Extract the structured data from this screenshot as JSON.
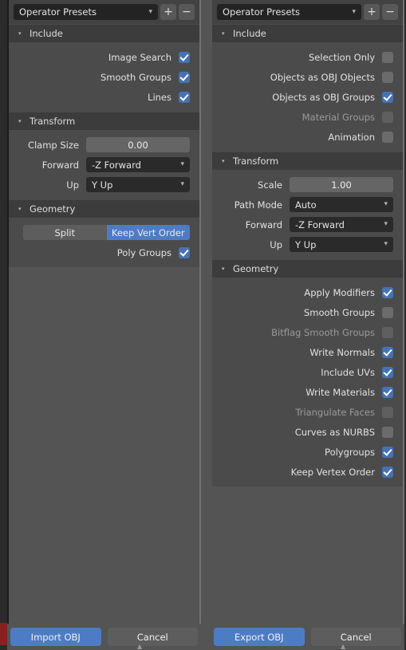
{
  "colors": {
    "accent_blue": "#4e7cc4",
    "checkbox_blue": "#4772b3",
    "panel_bg": "#545454",
    "body_bg": "#4b4b4b",
    "section_header_bg": "#3c3c3c",
    "window_bg": "#2b2b2b",
    "red_marker": "#8a1f1f"
  },
  "import_panel": {
    "preset": {
      "value": "Operator Presets",
      "chevron": "chevron-down-icon",
      "add_label": "+",
      "remove_label": "−"
    },
    "sections": [
      {
        "title": "Include",
        "triangle": "▾",
        "rows": [
          {
            "type": "checkbox",
            "label": "Image Search",
            "checked": true,
            "disabled": false
          },
          {
            "type": "checkbox",
            "label": "Smooth Groups",
            "checked": true,
            "disabled": false
          },
          {
            "type": "checkbox",
            "label": "Lines",
            "checked": true,
            "disabled": false
          }
        ]
      },
      {
        "title": "Transform",
        "triangle": "▾",
        "rows": [
          {
            "type": "value",
            "label": "Clamp Size",
            "value": "0.00"
          },
          {
            "type": "dropdown",
            "label": "Forward",
            "value": "-Z Forward"
          },
          {
            "type": "dropdown",
            "label": "Up",
            "value": "Y Up"
          }
        ]
      },
      {
        "title": "Geometry",
        "triangle": "▾",
        "rows": [
          {
            "type": "toggle",
            "options": [
              "Split",
              "Keep Vert Order"
            ],
            "selected": "Keep Vert Order"
          },
          {
            "type": "checkbox",
            "label": "Poly Groups",
            "checked": true,
            "disabled": false
          }
        ]
      }
    ],
    "buttons": {
      "confirm": "Import OBJ",
      "cancel": "Cancel"
    }
  },
  "export_panel": {
    "preset": {
      "value": "Operator Presets",
      "chevron": "chevron-down-icon",
      "add_label": "+",
      "remove_label": "−"
    },
    "sections": [
      {
        "title": "Include",
        "triangle": "▾",
        "rows": [
          {
            "type": "checkbox",
            "label": "Selection Only",
            "checked": false,
            "disabled": false
          },
          {
            "type": "checkbox",
            "label": "Objects as OBJ Objects",
            "checked": false,
            "disabled": false
          },
          {
            "type": "checkbox",
            "label": "Objects as OBJ Groups",
            "checked": true,
            "disabled": false
          },
          {
            "type": "checkbox",
            "label": "Material Groups",
            "checked": false,
            "disabled": true
          },
          {
            "type": "checkbox",
            "label": "Animation",
            "checked": false,
            "disabled": false
          }
        ]
      },
      {
        "title": "Transform",
        "triangle": "▾",
        "rows": [
          {
            "type": "value",
            "label": "Scale",
            "value": "1.00"
          },
          {
            "type": "dropdown",
            "label": "Path Mode",
            "value": "Auto"
          },
          {
            "type": "dropdown",
            "label": "Forward",
            "value": "-Z Forward"
          },
          {
            "type": "dropdown",
            "label": "Up",
            "value": "Y Up"
          }
        ]
      },
      {
        "title": "Geometry",
        "triangle": "▾",
        "rows": [
          {
            "type": "checkbox",
            "label": "Apply Modifiers",
            "checked": true,
            "disabled": false
          },
          {
            "type": "checkbox",
            "label": "Smooth Groups",
            "checked": false,
            "disabled": false
          },
          {
            "type": "checkbox",
            "label": "Bitflag Smooth Groups",
            "checked": false,
            "disabled": true
          },
          {
            "type": "checkbox",
            "label": "Write Normals",
            "checked": true,
            "disabled": false
          },
          {
            "type": "checkbox",
            "label": "Include UVs",
            "checked": true,
            "disabled": false
          },
          {
            "type": "checkbox",
            "label": "Write Materials",
            "checked": true,
            "disabled": false
          },
          {
            "type": "checkbox",
            "label": "Triangulate Faces",
            "checked": false,
            "disabled": true
          },
          {
            "type": "checkbox",
            "label": "Curves as NURBS",
            "checked": false,
            "disabled": false
          },
          {
            "type": "checkbox",
            "label": "Polygroups",
            "checked": true,
            "disabled": false
          },
          {
            "type": "checkbox",
            "label": "Keep Vertex Order",
            "checked": true,
            "disabled": false
          }
        ]
      }
    ],
    "buttons": {
      "confirm": "Export OBJ",
      "cancel": "Cancel"
    }
  }
}
